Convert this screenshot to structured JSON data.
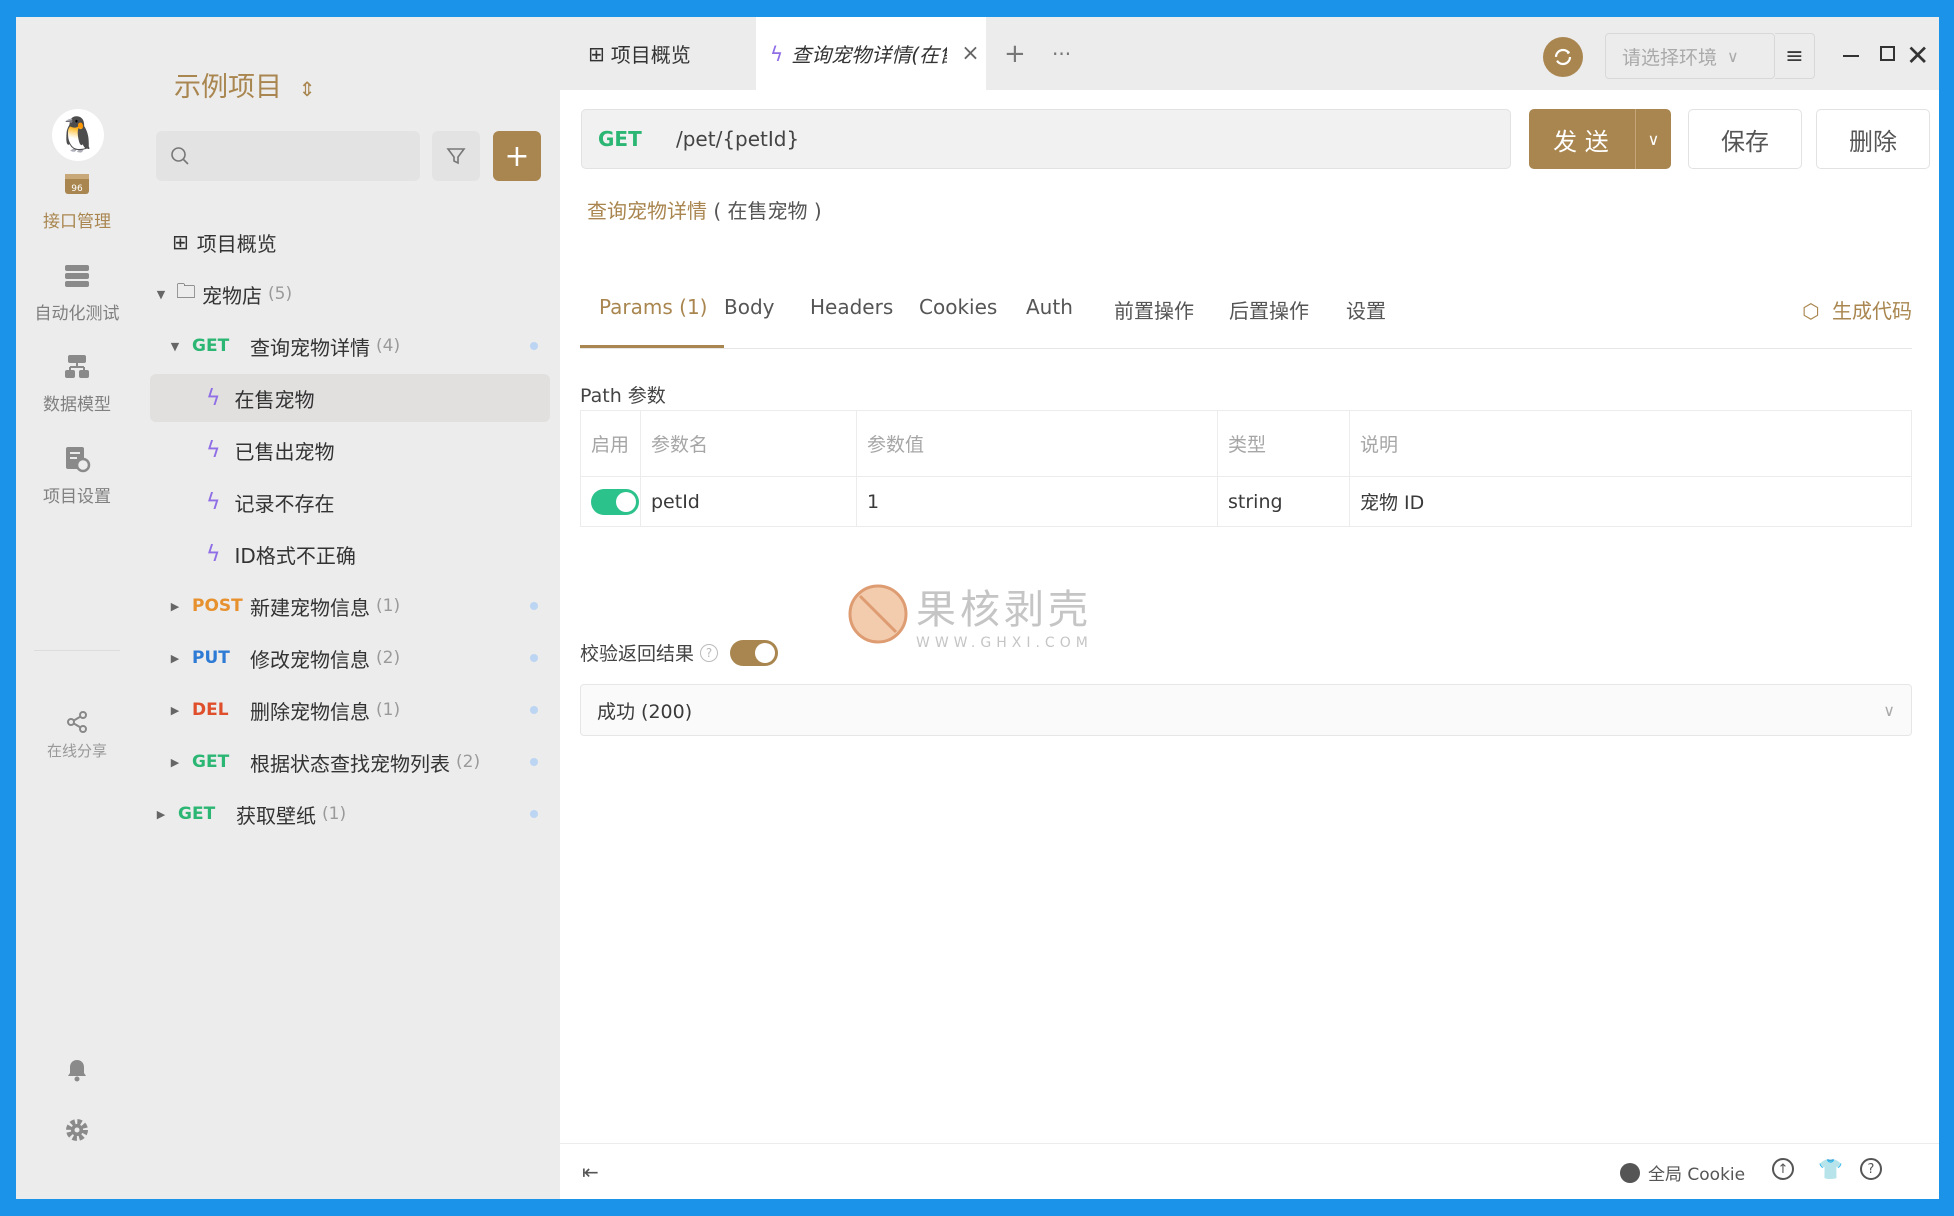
{
  "rail": {
    "items": [
      {
        "label": "接口管理",
        "icon": "api-manage-icon"
      },
      {
        "label": "自动化测试",
        "icon": "automation-icon"
      },
      {
        "label": "数据模型",
        "icon": "data-model-icon"
      },
      {
        "label": "项目设置",
        "icon": "project-settings-icon"
      },
      {
        "label": "在线分享",
        "icon": "share-icon"
      }
    ]
  },
  "sidebar": {
    "project_title": "示例项目",
    "tree": [
      {
        "label": "项目概览"
      },
      {
        "label": "宠物店",
        "count": "(5)"
      },
      {
        "method": "GET",
        "label": "查询宠物详情",
        "count": "(4)"
      },
      {
        "label": "在售宠物"
      },
      {
        "label": "已售出宠物"
      },
      {
        "label": "记录不存在"
      },
      {
        "label": "ID格式不正确"
      },
      {
        "method": "POST",
        "label": "新建宠物信息",
        "count": "(1)"
      },
      {
        "method": "PUT",
        "label": "修改宠物信息",
        "count": "(2)"
      },
      {
        "method": "DEL",
        "label": "删除宠物信息",
        "count": "(1)"
      },
      {
        "method": "GET",
        "label": "根据状态查找宠物列表",
        "count": "(2)"
      },
      {
        "method": "GET",
        "label": "获取壁纸",
        "count": "(1)"
      }
    ]
  },
  "tabs": {
    "overview": "项目概览",
    "active": "查询宠物详情(在售宠",
    "add": "+",
    "more": "···"
  },
  "env": {
    "placeholder": "请选择环境"
  },
  "request": {
    "method": "GET",
    "url": "/pet/{petId}",
    "send": "发 送",
    "save": "保存",
    "delete": "删除",
    "name": "查询宠物详情",
    "case": "( 在售宠物 )"
  },
  "param_tabs": [
    "Params (1)",
    "Body",
    "Headers",
    "Cookies",
    "Auth",
    "前置操作",
    "后置操作",
    "设置"
  ],
  "gen_code": "生成代码",
  "path_params": {
    "title": "Path 参数",
    "headers": [
      "启用",
      "参数名",
      "参数值",
      "类型",
      "说明"
    ],
    "rows": [
      {
        "name": "petId",
        "value": "1",
        "type": "string",
        "desc": "宠物 ID",
        "enabled": true
      }
    ]
  },
  "validate": {
    "label": "校验返回结果",
    "enabled": true,
    "selected": "成功 (200)"
  },
  "watermark": {
    "title": "果核剥壳",
    "url": "WWW.GHXI.COM"
  },
  "status_bar": {
    "cookie": "全局 Cookie"
  },
  "colors": {
    "brand": "#a9864f",
    "get": "#2bb673",
    "post": "#e7912e",
    "put": "#2e7bd6",
    "del": "#e04f2b",
    "accent_bolt": "#8f6ee6"
  }
}
